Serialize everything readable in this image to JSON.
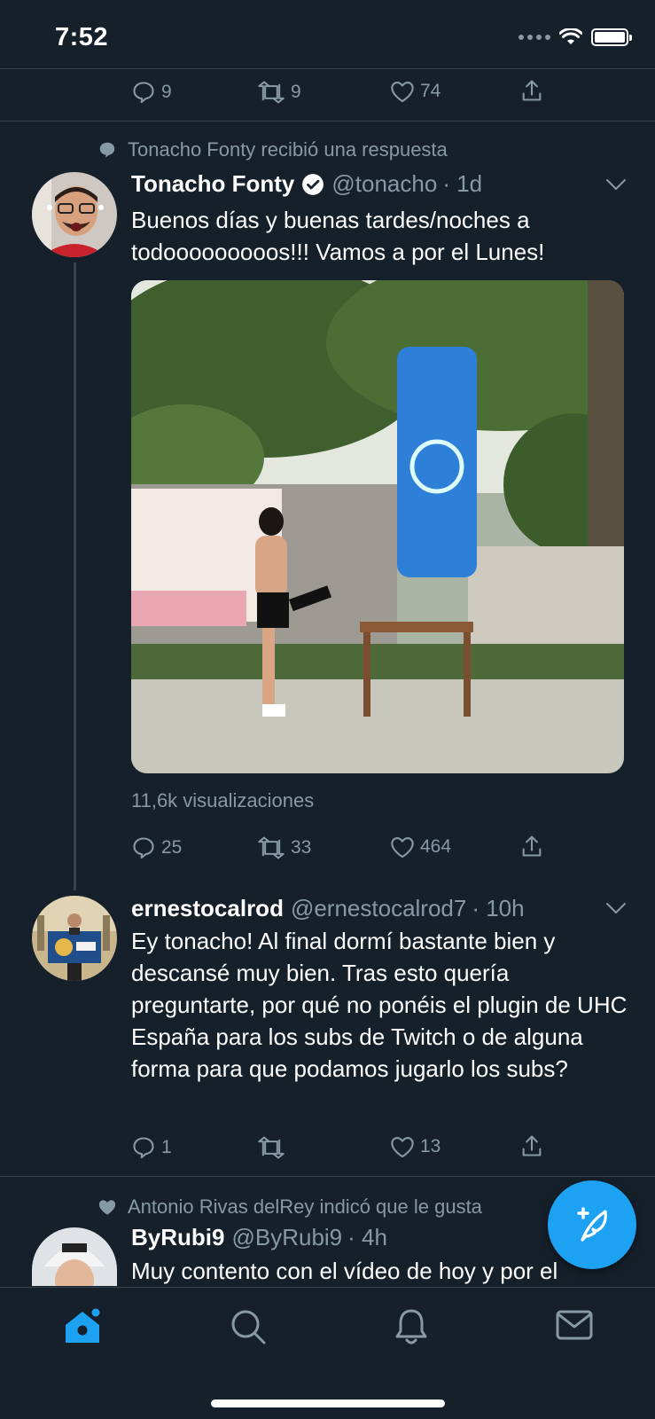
{
  "status_bar": {
    "time": "7:52"
  },
  "top_tweet_actions": {
    "replies": "9",
    "retweets": "9",
    "likes": "74"
  },
  "tweet1": {
    "context": "Tonacho Fonty recibió una respuesta",
    "name": "Tonacho Fonty",
    "handle": "@tonacho",
    "time": "· 1d",
    "text": "Buenos días y buenas tardes/noches a todooooooooos!!! Vamos a por el Lunes!",
    "views": "11,6k visualizaciones",
    "replies": "25",
    "retweets": "33",
    "likes": "464"
  },
  "tweet2": {
    "name": "ernestocalrod",
    "handle": "@ernestocalrod7",
    "time": "· 10h",
    "text": "Ey tonacho! Al final dormí bastante bien y descansé muy bien. Tras esto quería preguntarte, por qué no ponéis el plugin de UHC España para los subs de Twitch o de alguna forma para que podamos jugarlo los subs?",
    "replies": "1",
    "retweets": "",
    "likes": "13"
  },
  "tweet3": {
    "context": "Antonio Rivas delRey indicó que le gusta",
    "name": "ByRubi9",
    "handle": "@ByRubi9",
    "time": "· 4h",
    "text": "Muy contento con el vídeo de hoy y por el"
  },
  "colors": {
    "background": "#15202b",
    "accent": "#1da1f2",
    "muted": "#8899a6",
    "divider": "#38444d"
  },
  "icons": [
    "reply-icon",
    "retweet-icon",
    "like-icon",
    "share-icon",
    "verified-icon",
    "compose-icon",
    "home-icon",
    "search-icon",
    "notifications-icon",
    "messages-icon"
  ]
}
